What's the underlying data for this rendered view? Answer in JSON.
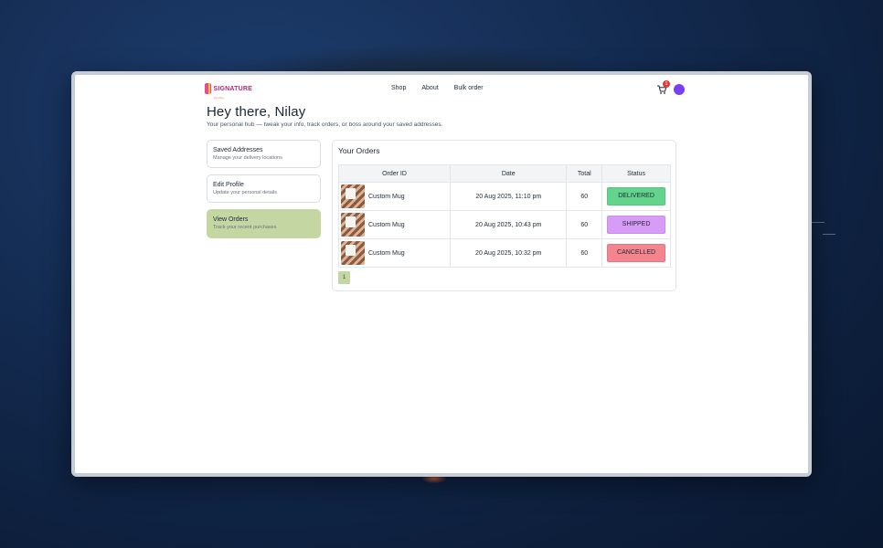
{
  "brand": {
    "name": "SIGNATURE",
    "tagline": "gift shop"
  },
  "nav": [
    {
      "label": "Shop"
    },
    {
      "label": "About"
    },
    {
      "label": "Bulk order"
    }
  ],
  "cart": {
    "count": "1"
  },
  "greeting": {
    "title": "Hey there, Nilay",
    "subtitle": "Your personal hub — tweak your info, track orders, or boss around your saved addresses."
  },
  "sidebar": [
    {
      "title": "Saved Addresses",
      "subtitle": "Manage your delivery locations",
      "active": false
    },
    {
      "title": "Edit Profile",
      "subtitle": "Update your personal details",
      "active": false
    },
    {
      "title": "View Orders",
      "subtitle": "Track your recent purchases",
      "active": true
    }
  ],
  "orders": {
    "heading": "Your Orders",
    "columns": [
      "Order ID",
      "Date",
      "Total",
      "Status"
    ],
    "rows": [
      {
        "product": "Custom Mug",
        "date": "20 Aug 2025, 11:10 pm",
        "total": "60",
        "status": "DELIVERED",
        "status_color": "#63d48c"
      },
      {
        "product": "Custom Mug",
        "date": "20 Aug 2025, 10:43 pm",
        "total": "60",
        "status": "SHIPPED",
        "status_color": "#d79cf5"
      },
      {
        "product": "Custom Mug",
        "date": "20 Aug 2025, 10:32 pm",
        "total": "60",
        "status": "CANCELLED",
        "status_color": "#f4858e"
      }
    ],
    "page": "1"
  },
  "colors": {
    "accent": "#c4d6a1",
    "cart_badge": "#e53935",
    "avatar": "#7b3ff2"
  }
}
